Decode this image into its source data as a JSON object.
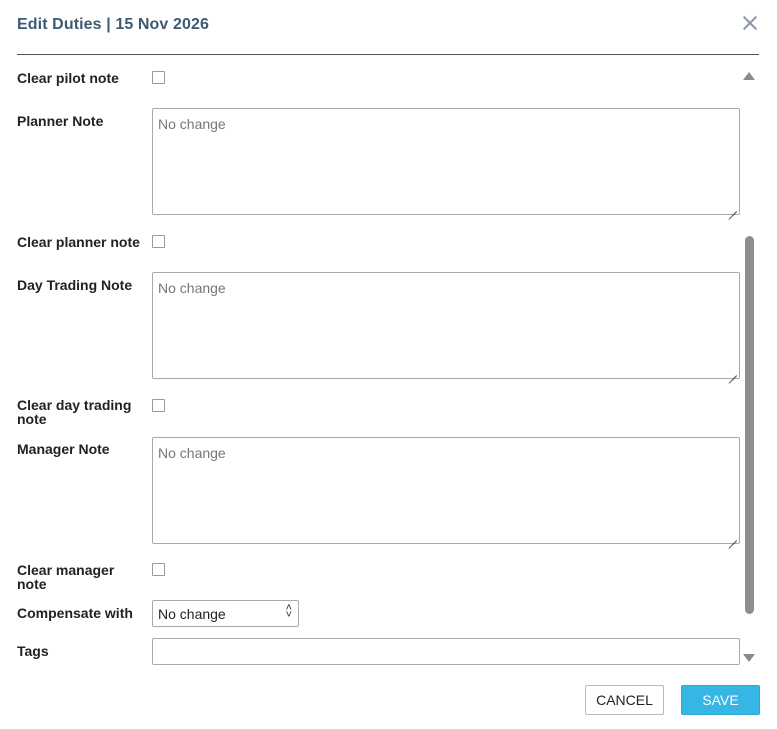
{
  "dialog": {
    "title": "Edit Duties | 15 Nov 2026"
  },
  "form": {
    "clear_pilot_note_label": "Clear pilot note",
    "planner_note_label": "Planner Note",
    "planner_note_placeholder": "No change",
    "clear_planner_note_label": "Clear planner note",
    "day_trading_note_label": "Day Trading Note",
    "day_trading_note_placeholder": "No change",
    "clear_day_trading_note_label": "Clear day trading note",
    "manager_note_label": "Manager Note",
    "manager_note_placeholder": "No change",
    "clear_manager_note_label": "Clear manager note",
    "compensate_with_label": "Compensate with",
    "compensate_with_value": "No change",
    "tags_label": "Tags",
    "tags_value": ""
  },
  "buttons": {
    "cancel": "CANCEL",
    "save": "SAVE"
  },
  "colors": {
    "title": "#3f5a73",
    "save_button": "#35b6e4"
  }
}
